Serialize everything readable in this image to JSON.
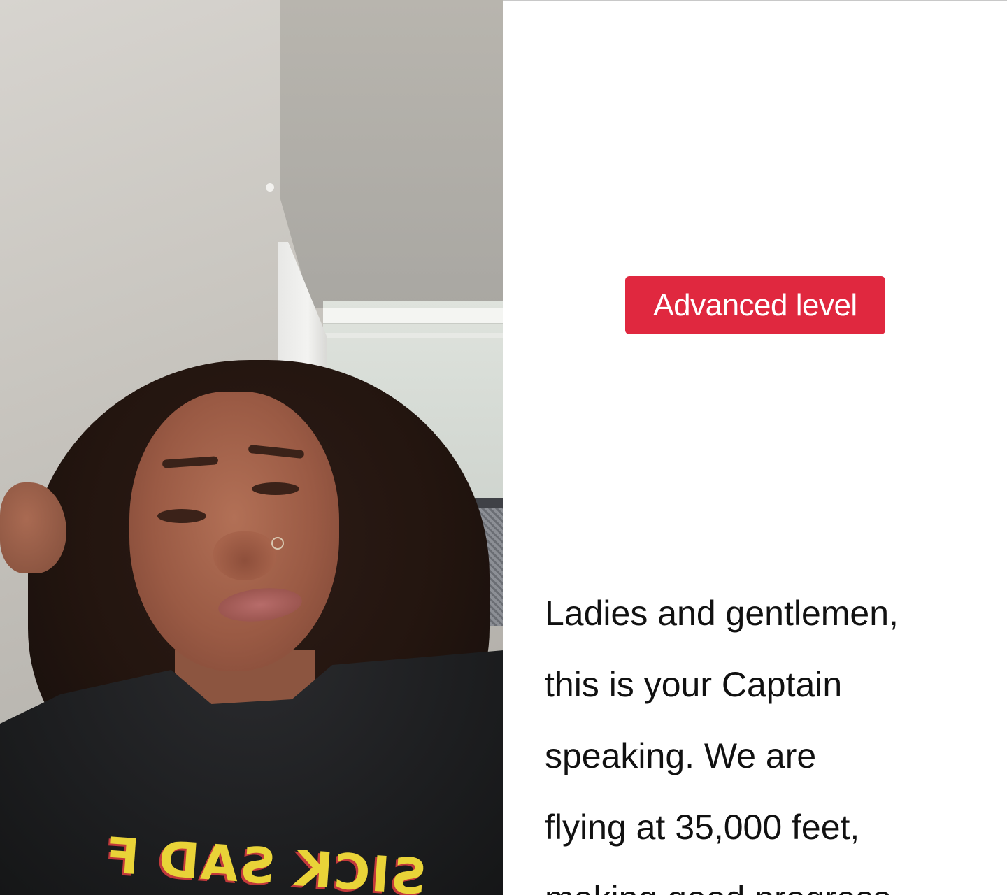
{
  "caption_panel": {
    "level_badge": "Advanced level",
    "announcement_lines": [
      "Ladies and gentlemen,",
      "this is your Captain",
      "speaking. We are",
      "flying at 35,000 feet,",
      "making good progress"
    ]
  },
  "camera_view": {
    "shirt_print": "SICK SAD FICTION"
  },
  "colors": {
    "badge_background": "#e0283f",
    "badge_text": "#ffffff",
    "caption_text": "#111111",
    "panel_background": "#ffffff"
  }
}
